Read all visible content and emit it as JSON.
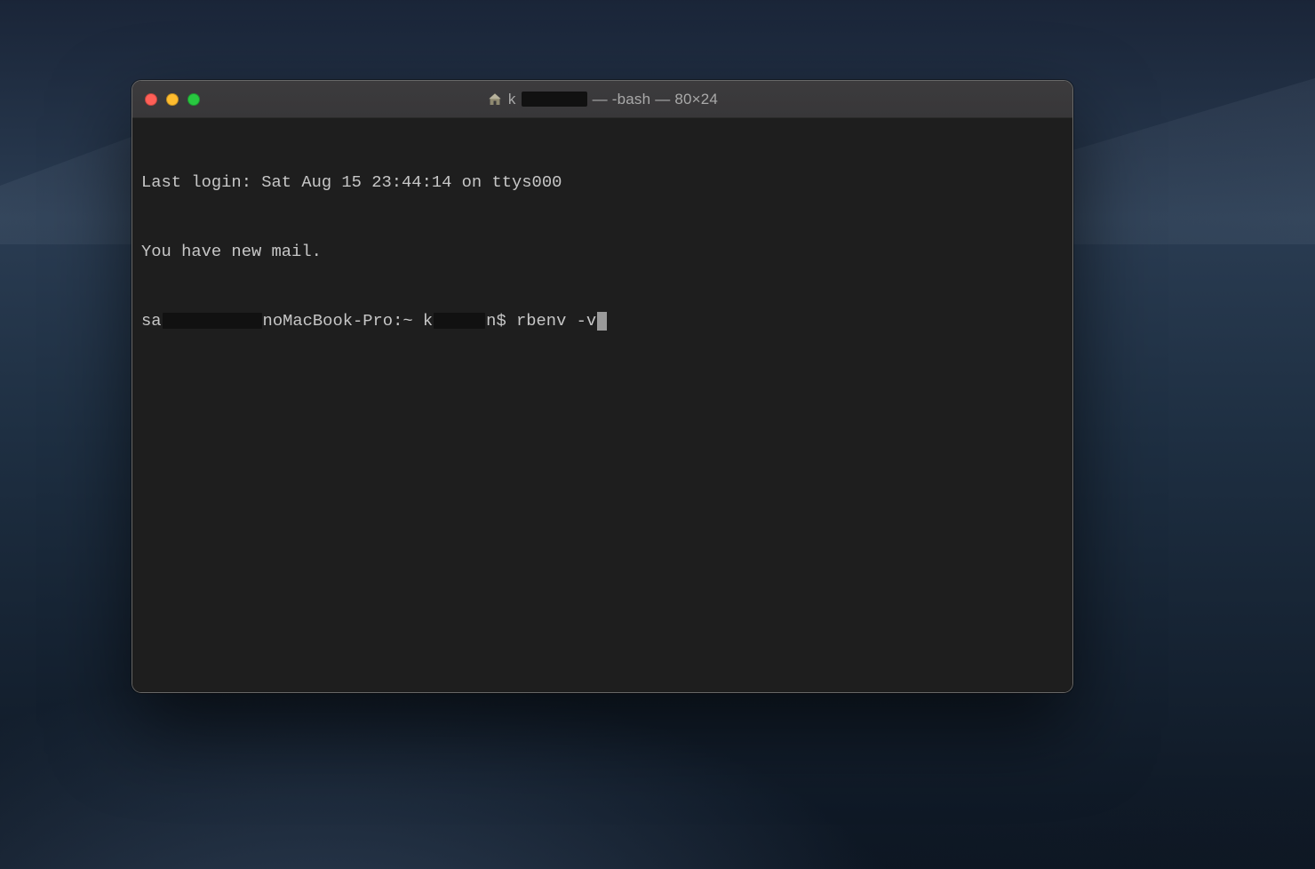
{
  "window": {
    "title_prefix": "k",
    "title_suffix": "— -bash — 80×24"
  },
  "terminal": {
    "line1": "Last login: Sat Aug 15 23:44:14 on ttys000",
    "line2": "You have new mail.",
    "prompt_prefix": "sa",
    "prompt_mid": "noMacBook-Pro:~ k",
    "prompt_user_tail": "n",
    "prompt_symbol": "$ ",
    "command": "rbenv -v"
  }
}
